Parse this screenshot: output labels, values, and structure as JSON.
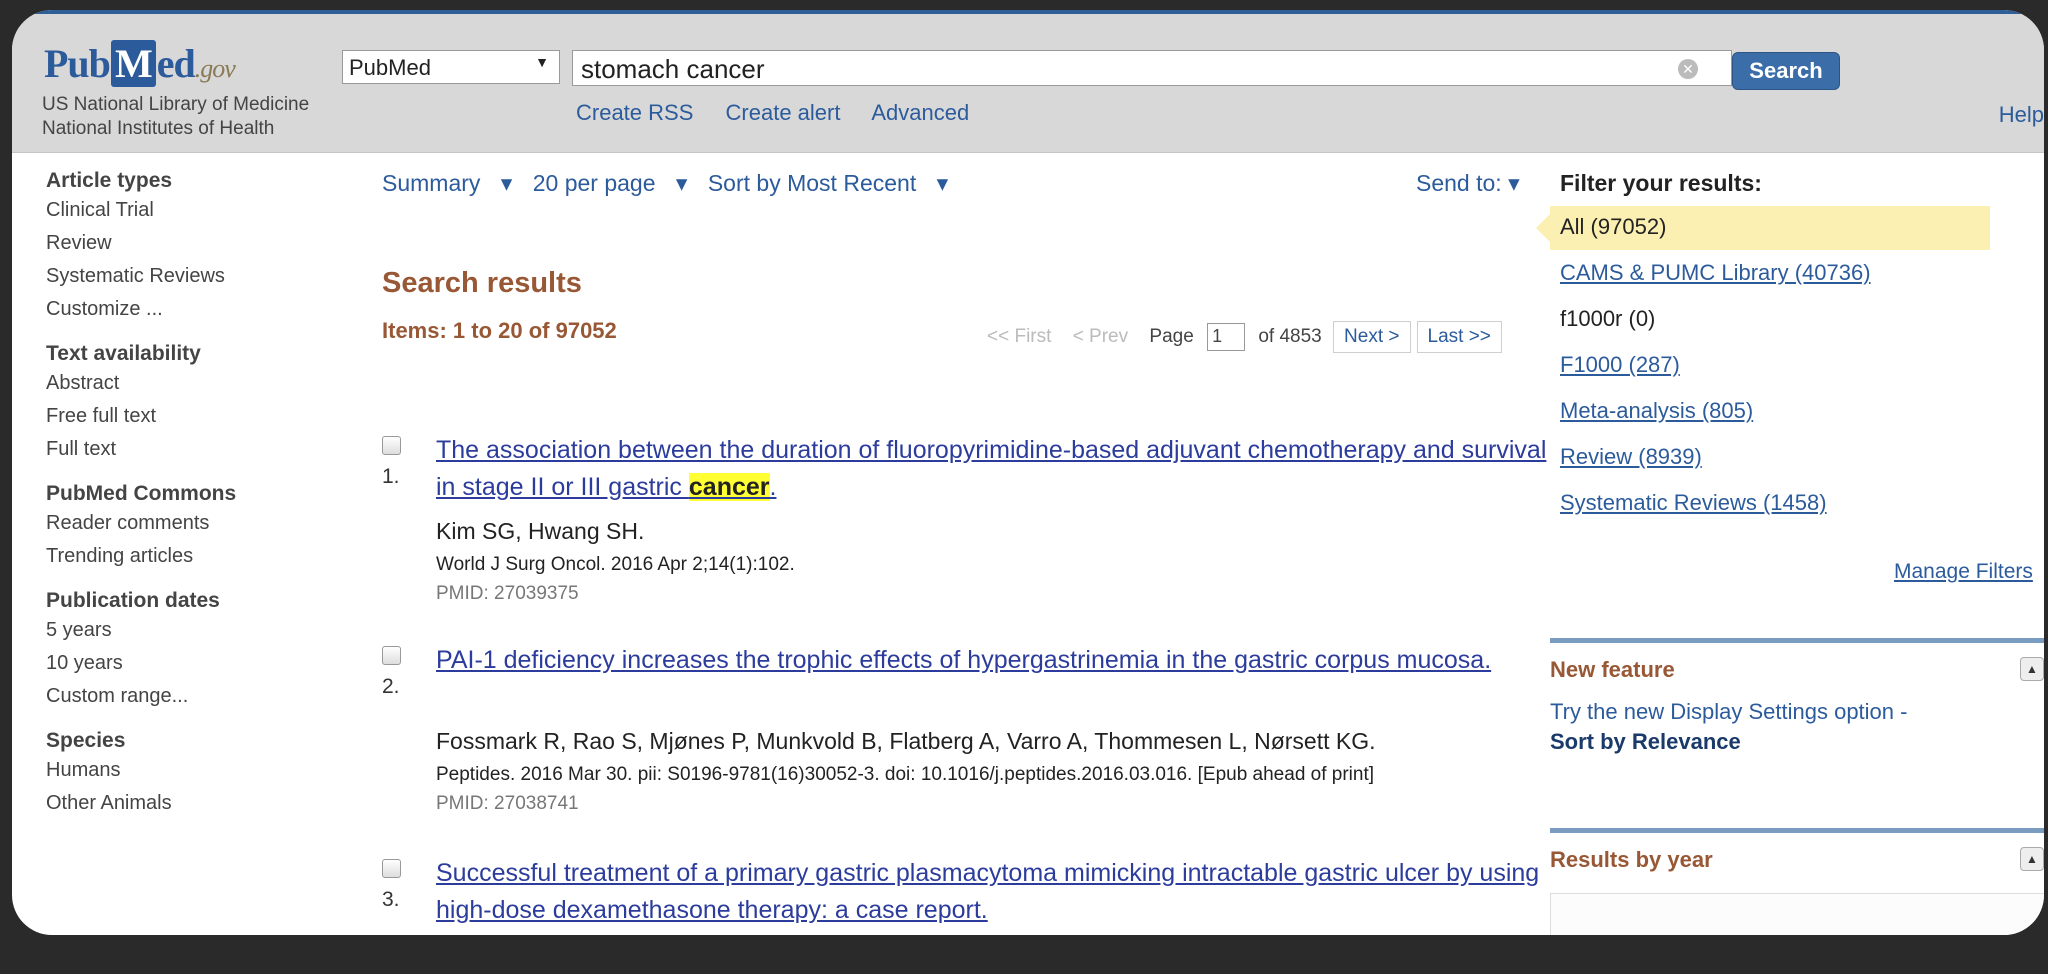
{
  "header": {
    "logo": {
      "pub": "Pub",
      "m": "M",
      "ed": "ed",
      "gov": ".gov"
    },
    "library": "US National Library of Medicine National Institutes of Health",
    "database": "PubMed",
    "query": "stomach cancer",
    "search_label": "Search",
    "links": [
      "Create RSS",
      "Create alert",
      "Advanced"
    ],
    "help": "Help"
  },
  "sidebar": {
    "groups": [
      {
        "title": "Article types",
        "items": [
          "Clinical Trial",
          "Review",
          "Systematic Reviews",
          "Customize ..."
        ]
      },
      {
        "title": "Text availability",
        "items": [
          "Abstract",
          "Free full text",
          "Full text"
        ]
      },
      {
        "title": "PubMed Commons",
        "items": [
          "Reader comments",
          "Trending articles"
        ]
      },
      {
        "title": "Publication dates",
        "items": [
          "5 years",
          "10 years",
          "Custom range..."
        ]
      },
      {
        "title": "Species",
        "items": [
          "Humans",
          "Other Animals"
        ]
      }
    ]
  },
  "toolbar": {
    "summary": "Summary",
    "per_page": "20 per page",
    "sort": "Sort by Most Recent",
    "send_to": "Send to:"
  },
  "results": {
    "heading": "Search results",
    "items_count": "Items: 1 to 20 of 97052",
    "pager": {
      "first": "<< First",
      "prev": "< Prev",
      "page_label": "Page",
      "page": "1",
      "of": "of 4853",
      "next": "Next >",
      "last": "Last >>"
    },
    "list": [
      {
        "num": "1.",
        "title_pre": "The association between the duration of fluoropyrimidine-based adjuvant chemotherapy and survival in stage II or III gastric ",
        "title_hl": "cancer",
        "title_post": ".",
        "authors": "Kim SG, Hwang SH.",
        "journal": "World J Surg Oncol. 2016 Apr 2;14(1):102.",
        "pmid": "PMID: 27039375"
      },
      {
        "num": "2.",
        "title_pre": "PAI-1 deficiency increases the trophic effects of hypergastrinemia in the gastric corpus mucosa.",
        "title_hl": "",
        "title_post": "",
        "authors": "Fossmark R, Rao S, Mjønes P, Munkvold B, Flatberg A, Varro A, Thommesen L, Nørsett KG.",
        "journal": "Peptides. 2016 Mar 30. pii: S0196-9781(16)30052-3. doi: 10.1016/j.peptides.2016.03.016. [Epub ahead of print]",
        "pmid": "PMID: 27038741"
      },
      {
        "num": "3.",
        "title_pre": "Successful treatment of a primary gastric plasmacytoma mimicking intractable gastric ulcer by using high-dose dexamethasone therapy: a case report.",
        "title_hl": "",
        "title_post": "",
        "authors": "",
        "journal": "",
        "pmid": ""
      }
    ]
  },
  "filters": {
    "title": "Filter your results:",
    "items": [
      {
        "label": "All (97052)",
        "selected": true
      },
      {
        "label": "CAMS & PUMC Library (40736)"
      },
      {
        "label": "f1000r (0)",
        "plain": true
      },
      {
        "label": "F1000 (287)"
      },
      {
        "label": "Meta-analysis (805)"
      },
      {
        "label": "Review (8939)"
      },
      {
        "label": "Systematic Reviews (1458)"
      }
    ],
    "manage": "Manage Filters"
  },
  "new_feature": {
    "title": "New feature",
    "text": "Try the new Display Settings option -",
    "bold": "Sort by Relevance"
  },
  "results_by_year": {
    "title": "Results by year"
  },
  "colors": {
    "brand": "#2c5b9c",
    "heading": "#985735",
    "highlight": "#ffff33"
  }
}
